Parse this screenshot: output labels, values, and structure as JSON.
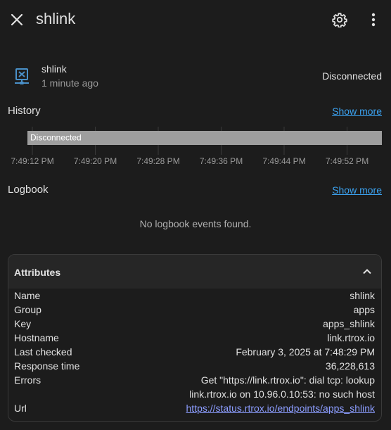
{
  "header": {
    "title": "shlink",
    "close_icon": "close-icon",
    "settings_icon": "gear-icon",
    "more_icon": "more-vertical-icon"
  },
  "entity": {
    "icon": "server-network-off-icon",
    "name": "shlink",
    "last_changed": "1 minute ago",
    "state": "Disconnected"
  },
  "history": {
    "title": "History",
    "show_more": "Show more",
    "bar_label": "Disconnected",
    "bar_color": "#9e9e9e",
    "ticks": [
      "7:49:12 PM",
      "7:49:20 PM",
      "7:49:28 PM",
      "7:49:36 PM",
      "7:49:44 PM",
      "7:49:52 PM"
    ]
  },
  "logbook": {
    "title": "Logbook",
    "show_more": "Show more",
    "empty_text": "No logbook events found."
  },
  "attributes": {
    "title": "Attributes",
    "rows": [
      {
        "key": "Name",
        "value": "shlink"
      },
      {
        "key": "Group",
        "value": "apps"
      },
      {
        "key": "Key",
        "value": "apps_shlink"
      },
      {
        "key": "Hostname",
        "value": "link.rtrox.io"
      },
      {
        "key": "Last checked",
        "value": "February 3, 2025 at 7:48:29 PM"
      },
      {
        "key": "Response time",
        "value": "36,228,613"
      },
      {
        "key": "Errors",
        "value_line1": "Get \"https://link.rtrox.io\": dial tcp: lookup",
        "value_line2": "link.rtrox.io on 10.96.0.10:53: no such host"
      },
      {
        "key": "Url",
        "value": "https://status.rtrox.io/endpoints/apps_shlink"
      }
    ]
  },
  "colors": {
    "background": "#1c1c1c",
    "link": "#3ba2f0",
    "icon_blue": "#4a90c8"
  }
}
